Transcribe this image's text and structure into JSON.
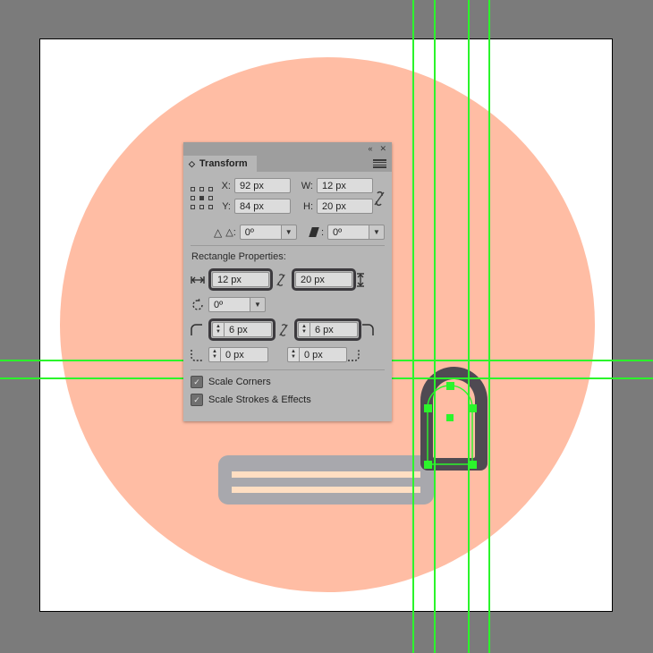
{
  "app": {
    "canvas_background": "#7b7b7b",
    "artboard_background": "#ffffff"
  },
  "artwork": {
    "circle": {
      "name": "peach-circle",
      "color": "#ffbda4"
    },
    "bar": {
      "name": "gray-rounded-bar",
      "color": "#a8a8ad",
      "line_color": "#ffdec2",
      "line_count": 2
    },
    "arch": {
      "name": "arch-shape",
      "stroke_color": "#4f4a52",
      "fill_color": "#ffbda4"
    },
    "guides": {
      "color": "#2bf52b",
      "vertical_count": 4,
      "horizontal_count": 2
    },
    "selection": {
      "handle_color": "#2bf52b"
    }
  },
  "panel": {
    "title": "Transform",
    "collapse_label": "«",
    "close_label": "✕",
    "menu_label": "menu",
    "fields": {
      "x_label": "X:",
      "x_value": "92 px",
      "y_label": "Y:",
      "y_value": "84 px",
      "w_label": "W:",
      "w_value": "12 px",
      "h_label": "H:",
      "h_value": "20 px",
      "rotate_label": "△:",
      "rotate_value": "0º",
      "shear_label": ":",
      "shear_value": "0º"
    },
    "rectangle_properties": {
      "section_label": "Rectangle Properties:",
      "width_value": "12 px",
      "height_value": "20 px",
      "angle_value": "0º",
      "corner_tl_value": "6 px",
      "corner_tr_value": "6 px",
      "corner_bl_value": "0 px",
      "corner_br_value": "0 px"
    },
    "options": [
      {
        "label": "Scale Corners",
        "checked": true
      },
      {
        "label": "Scale Strokes & Effects",
        "checked": true
      }
    ]
  }
}
